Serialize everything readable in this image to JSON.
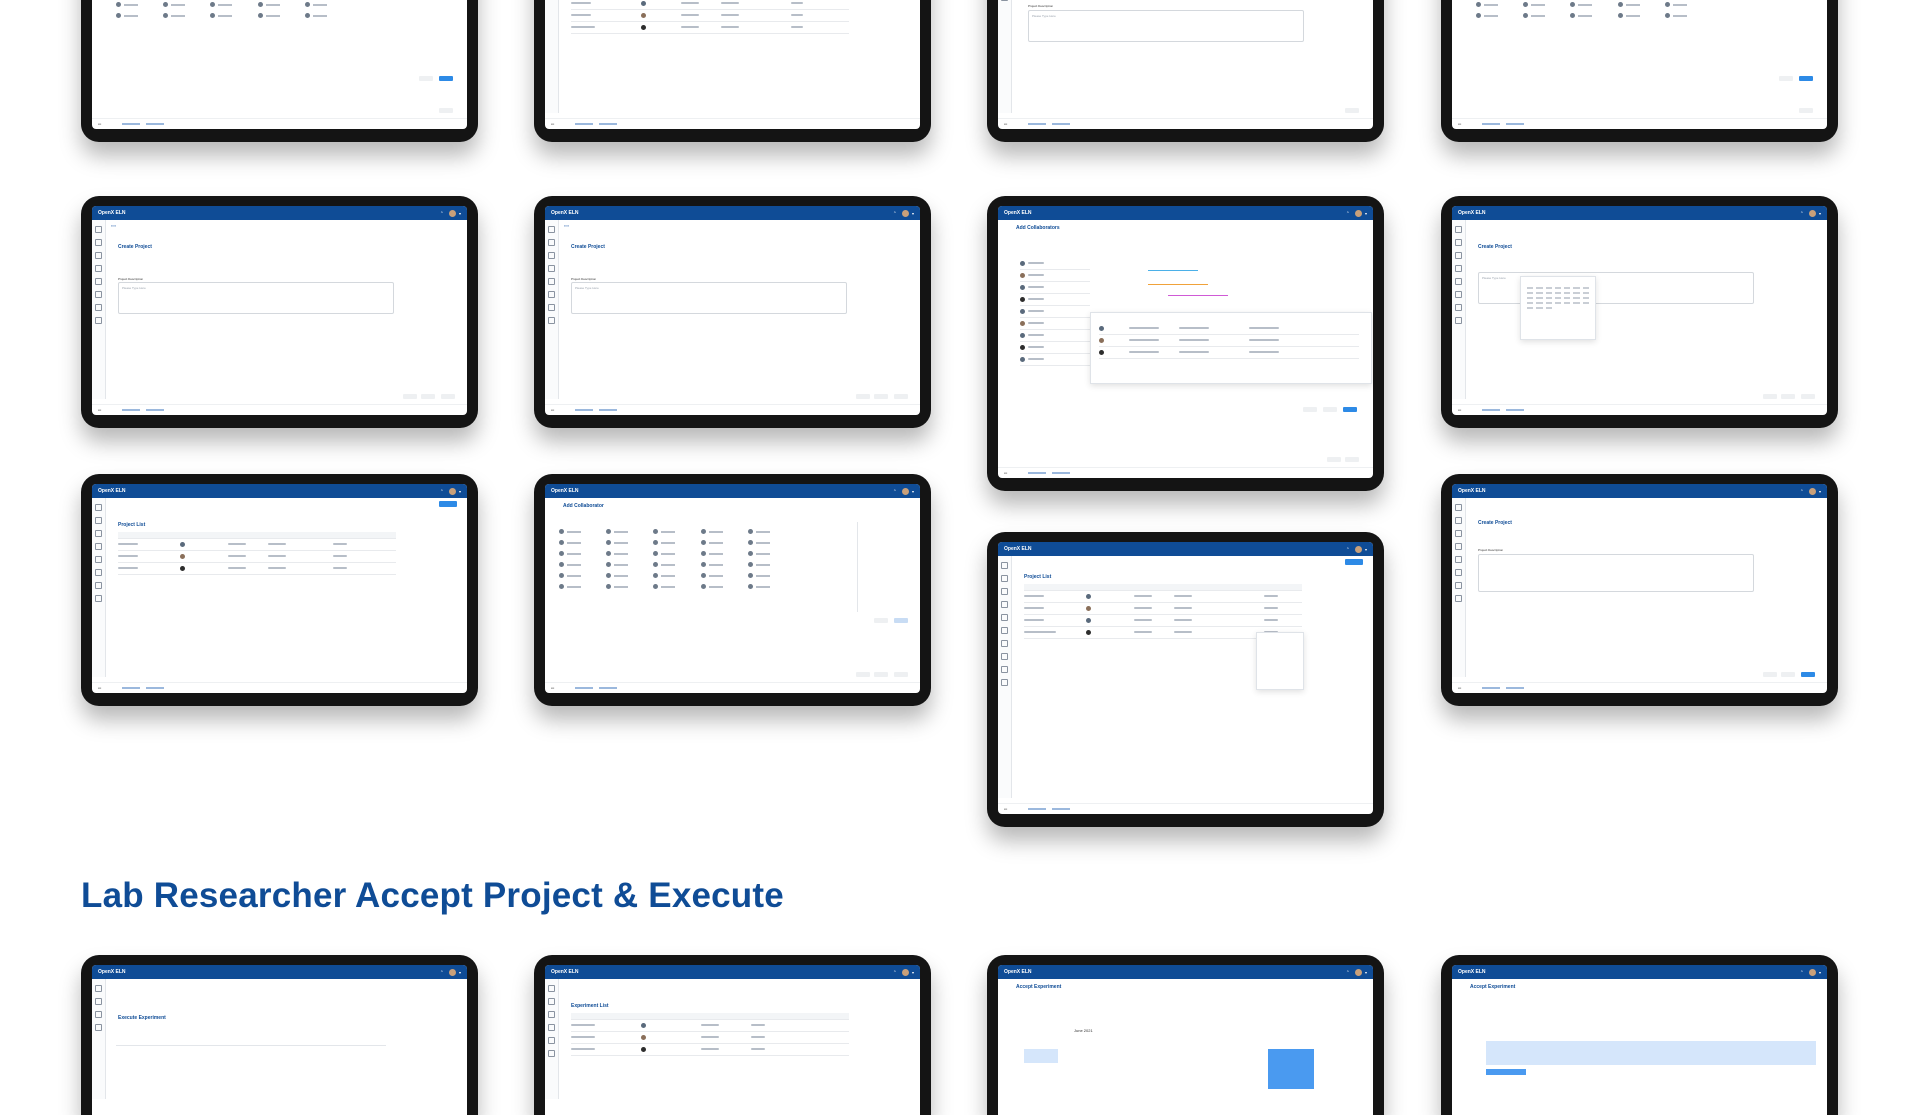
{
  "section_title": "Lab Researcher Accept Project & Execute",
  "app": {
    "brand": "OpenX ELN"
  },
  "screens": {
    "create_project": {
      "title": "Create Project",
      "description_placeholder": "Please Type Here",
      "description_label": "Project Description"
    },
    "add_collaborators": {
      "title": "Add Collaborators"
    },
    "add_collaborator": {
      "title": "Add Collaborator"
    },
    "project_list": {
      "title": "Project List"
    },
    "execute_experiment": {
      "title": "Execute Experiment"
    },
    "experiment_list": {
      "title": "Experiment List"
    },
    "accept_experiment": {
      "title": "Accept Experiment",
      "month": "June 2021"
    }
  },
  "colors": {
    "primary": "#0f4c96",
    "accent": "#2d8ae6",
    "frame": "#141414"
  }
}
